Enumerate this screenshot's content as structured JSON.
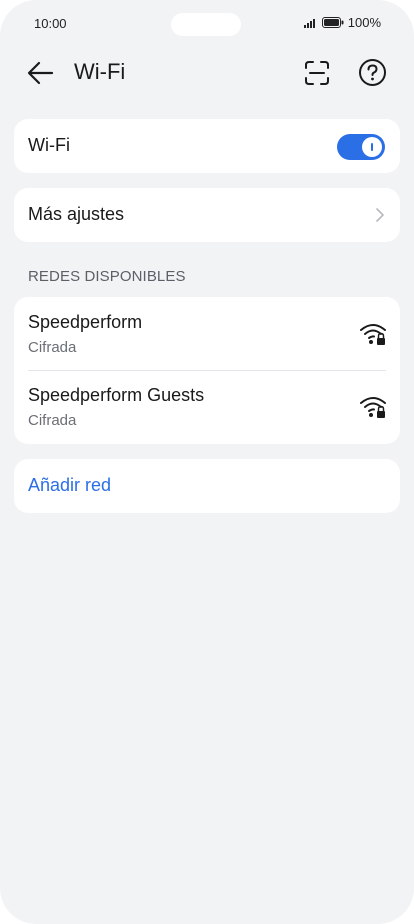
{
  "status": {
    "time": "10:00",
    "battery": "100%"
  },
  "header": {
    "title": "Wi-Fi"
  },
  "wifi_row": {
    "label": "Wi-Fi",
    "enabled": true
  },
  "more_row": {
    "label": "Más ajustes"
  },
  "networks": {
    "section_label": "REDES DISPONIBLES",
    "items": [
      {
        "name": "Speedperform",
        "security": "Cifrada"
      },
      {
        "name": "Speedperform Guests",
        "security": "Cifrada"
      }
    ]
  },
  "add_network": {
    "label": "Añadir red"
  },
  "colors": {
    "accent": "#2b6fe6",
    "background": "#f1f3f5",
    "card": "#ffffff"
  },
  "icons": [
    "back-arrow-icon",
    "scan-icon",
    "help-icon",
    "chevron-right-icon",
    "wifi-lock-icon",
    "signal-icon",
    "battery-icon"
  ]
}
